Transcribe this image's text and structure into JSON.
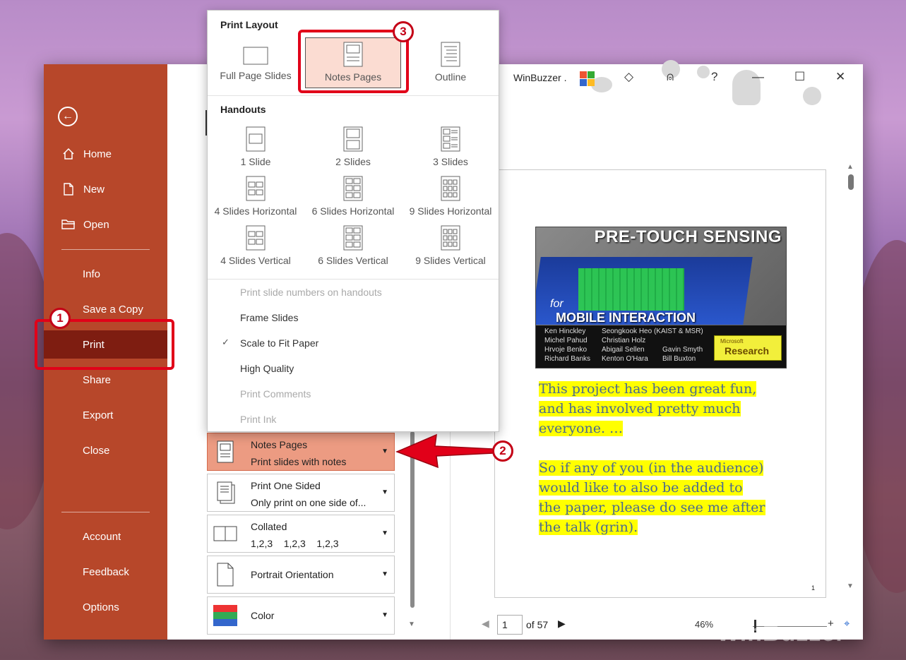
{
  "window": {
    "title": "WinBuzzer ."
  },
  "nav": {
    "back_label": "←",
    "items": [
      {
        "label": "Home"
      },
      {
        "label": "New"
      },
      {
        "label": "Open"
      },
      {
        "label": "Info"
      },
      {
        "label": "Save a Copy"
      },
      {
        "label": "Print"
      },
      {
        "label": "Share"
      },
      {
        "label": "Export"
      },
      {
        "label": "Close"
      },
      {
        "label": "Account"
      },
      {
        "label": "Feedback"
      },
      {
        "label": "Options"
      }
    ]
  },
  "popup": {
    "print_layout_title": "Print Layout",
    "layouts": [
      {
        "label": "Full Page Slides"
      },
      {
        "label": "Notes Pages"
      },
      {
        "label": "Outline"
      }
    ],
    "handouts_title": "Handouts",
    "handouts": [
      {
        "label": "1 Slide"
      },
      {
        "label": "2 Slides"
      },
      {
        "label": "3 Slides"
      },
      {
        "label": "4 Slides Horizontal"
      },
      {
        "label": "6 Slides Horizontal"
      },
      {
        "label": "9 Slides Horizontal"
      },
      {
        "label": "4 Slides Vertical"
      },
      {
        "label": "6 Slides Vertical"
      },
      {
        "label": "9 Slides Vertical"
      }
    ],
    "options": [
      {
        "label": "Print slide numbers on handouts",
        "disabled": true
      },
      {
        "label": "Frame Slides",
        "disabled": false
      },
      {
        "label": "Scale to Fit Paper",
        "disabled": false,
        "checked": true
      },
      {
        "label": "High Quality",
        "disabled": false
      },
      {
        "label": "Print Comments",
        "disabled": true
      },
      {
        "label": "Print Ink",
        "disabled": true
      }
    ],
    "check_mark": "✓"
  },
  "settings": [
    {
      "line1": "Notes Pages",
      "line2": "Print slides with notes"
    },
    {
      "line1": "Print One Sided",
      "line2": "Only print on one side of..."
    },
    {
      "line1": "Collated",
      "line2": "1,2,3    1,2,3    1,2,3"
    },
    {
      "line1": "Portrait Orientation"
    },
    {
      "line1": "Color"
    }
  ],
  "preview": {
    "slide_title": "PRE-TOUCH SENSING",
    "slide_for": "for",
    "slide_subtitle": "MOBILE INTERACTION",
    "authors": [
      "Ken Hinckley",
      "Seongkook Heo (KAIST & MSR)",
      "Michel Pahud",
      "Christian Holz",
      "Hrvoje Benko",
      "Abigail Sellen",
      "Gavin Smyth",
      "Richard Banks",
      "Kenton O'Hara",
      "Bill Buxton"
    ],
    "badge_small": "Microsoft",
    "badge_big": "Research",
    "notes_p1": [
      "This project has been great fun,",
      "and has involved pretty much",
      "everyone. …"
    ],
    "notes_p2": [
      "So if any of you (in the audience)",
      "would like to also be added to",
      "the paper, please do see me after",
      "the talk (grin)."
    ],
    "page_number": "1"
  },
  "pager": {
    "current": "1",
    "of_label": "of 57"
  },
  "zoom": {
    "level": "46%",
    "plus": "+"
  },
  "annotations": [
    "1",
    "2",
    "3"
  ],
  "watermark": "WinBuzzer",
  "colors": {
    "backstage": "#b7472a",
    "active": "#7e1d11",
    "annotation": "#e10019"
  }
}
